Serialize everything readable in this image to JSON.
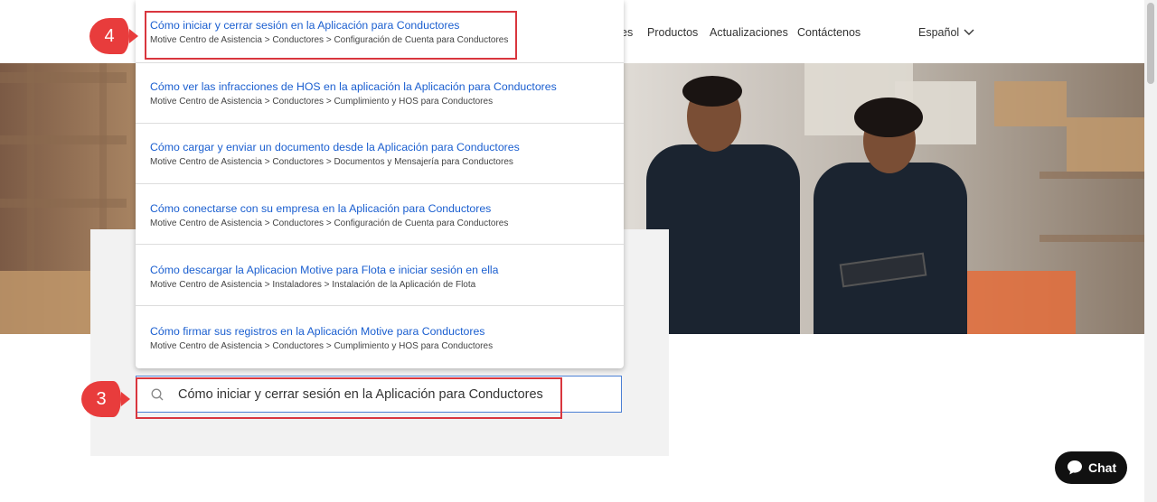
{
  "nav": {
    "partial_item": "es",
    "items": [
      "Productos",
      "Actualizaciones",
      "Contáctenos"
    ],
    "language": "Español"
  },
  "search": {
    "query": "Cómo iniciar y cerrar sesión en la Aplicación para Conductores"
  },
  "results": [
    {
      "title": "Cómo iniciar y cerrar sesión en la Aplicación para Conductores",
      "crumb": "Motive Centro de Asistencia > Conductores > Configuración de Cuenta para Conductores"
    },
    {
      "title": "Cómo ver las infracciones de HOS en la aplicación la Aplicación para Conductores",
      "crumb": "Motive Centro de Asistencia > Conductores > Cumplimiento y HOS para Conductores"
    },
    {
      "title": "Cómo cargar y enviar un documento desde la Aplicación para Conductores",
      "crumb": "Motive Centro de Asistencia > Conductores > Documentos y Mensajería para Conductores"
    },
    {
      "title": "Cómo conectarse con su empresa en la Aplicación para Conductores",
      "crumb": "Motive Centro de Asistencia > Conductores > Configuración de Cuenta para Conductores"
    },
    {
      "title": "Cómo descargar la Aplicacion Motive para Flota e iniciar sesión en ella",
      "crumb": "Motive Centro de Asistencia > Instaladores > Instalación de la Aplicación de Flota"
    },
    {
      "title": "Cómo firmar sus registros en la Aplicación Motive para Conductores",
      "crumb": "Motive Centro de Asistencia > Conductores > Cumplimiento y HOS para Conductores"
    }
  ],
  "annotations": {
    "step3": "3",
    "step4": "4"
  },
  "chat": {
    "label": "Chat"
  },
  "colors": {
    "accent": "#e83c3c",
    "link": "#1b5fd0"
  }
}
